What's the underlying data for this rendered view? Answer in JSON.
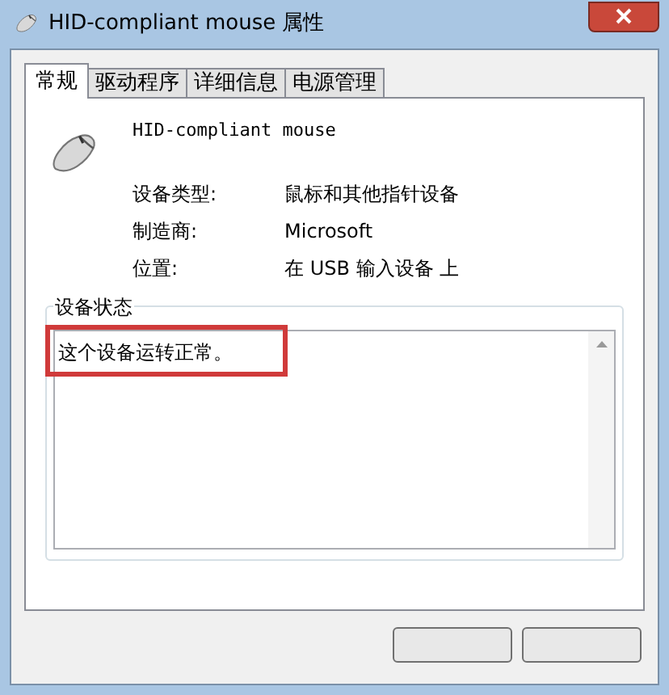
{
  "window": {
    "title": "HID-compliant mouse 属性"
  },
  "tabs": [
    {
      "label": "常规",
      "selected": true
    },
    {
      "label": "驱动程序",
      "selected": false
    },
    {
      "label": "详细信息",
      "selected": false
    },
    {
      "label": "电源管理",
      "selected": false
    }
  ],
  "device_name": "HID-compliant mouse",
  "properties": [
    {
      "label": "设备类型:",
      "value": "鼠标和其他指针设备"
    },
    {
      "label": "制造商:",
      "value": "Microsoft"
    },
    {
      "label": "位置:",
      "value": "在 USB 输入设备 上"
    }
  ],
  "device_status": {
    "title": "设备状态",
    "value": "这个设备运转正常。"
  }
}
